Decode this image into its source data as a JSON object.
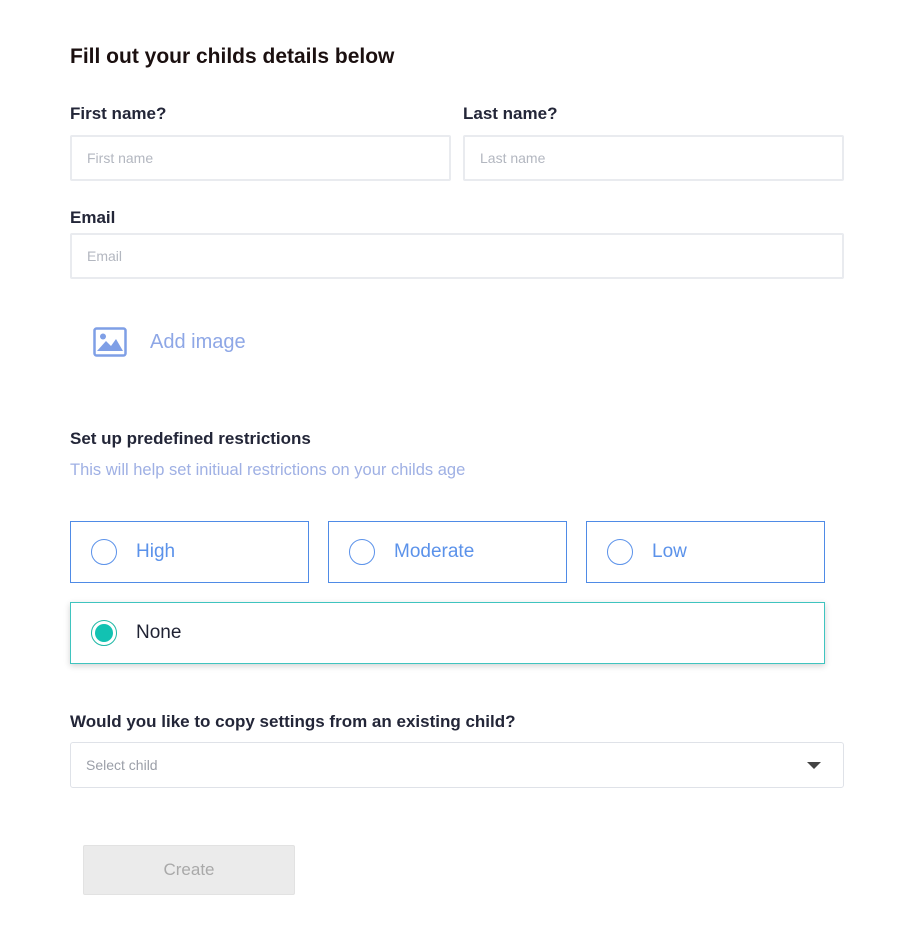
{
  "form": {
    "title": "Fill out your childs details below",
    "first_name": {
      "label": "First name?",
      "placeholder": "First name",
      "value": ""
    },
    "last_name": {
      "label": "Last name?",
      "placeholder": "Last name",
      "value": ""
    },
    "email": {
      "label": "Email",
      "placeholder": "Email",
      "value": ""
    },
    "add_image": {
      "label": "Add image",
      "icon": "image-icon"
    }
  },
  "restrictions": {
    "title": "Set up predefined restrictions",
    "subtitle": "This will help set initiual restrictions on your childs age",
    "options": [
      {
        "label": "High",
        "selected": false
      },
      {
        "label": "Moderate",
        "selected": false
      },
      {
        "label": "Low",
        "selected": false
      },
      {
        "label": "None",
        "selected": true
      }
    ]
  },
  "copy_settings": {
    "label": "Would you like to copy settings from an existing child?",
    "placeholder": "Select child",
    "icon": "chevron-down-icon"
  },
  "actions": {
    "create_label": "Create"
  },
  "colors": {
    "accent_blue": "#5b92ea",
    "selected_teal": "#12c2b2",
    "button_disabled_bg": "#ebebeb"
  }
}
